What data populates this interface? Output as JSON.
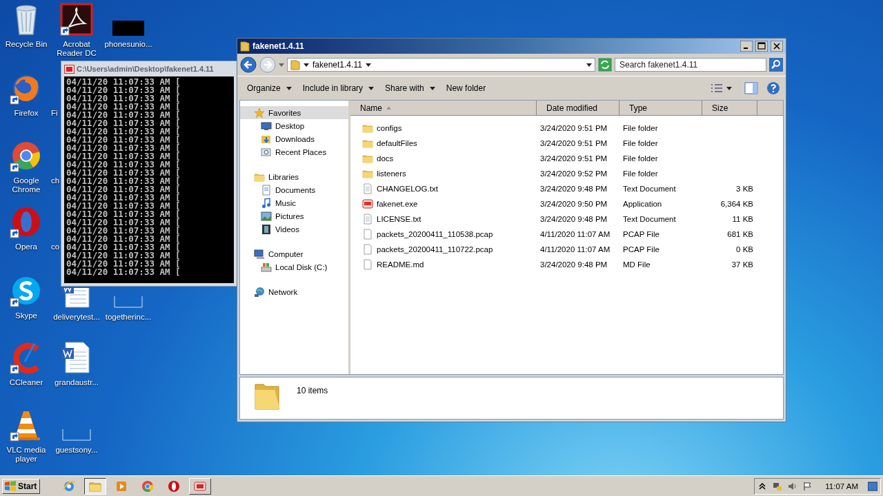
{
  "desktop_icons": [
    {
      "label": "Recycle Bin",
      "kind": "recycle-bin"
    },
    {
      "label": "Acrobat Reader DC",
      "kind": "pdf",
      "shortcut": true
    },
    {
      "label": "phonesunio...",
      "kind": "black-tile"
    },
    {
      "label": "Firefox",
      "kind": "firefox",
      "shortcut": true
    },
    {
      "label": "Fi",
      "kind": "covered"
    },
    {
      "label": "Google Chrome",
      "kind": "chrome",
      "shortcut": true
    },
    {
      "label": "ch",
      "kind": "covered"
    },
    {
      "label": "Opera",
      "kind": "opera",
      "shortcut": true
    },
    {
      "label": "co",
      "kind": "covered"
    },
    {
      "label": "Skype",
      "kind": "skype",
      "shortcut": true
    },
    {
      "label": "deliverytest...",
      "kind": "word"
    },
    {
      "label": "togetherinc...",
      "kind": "outline"
    },
    {
      "label": "CCleaner",
      "kind": "ccleaner",
      "shortcut": true
    },
    {
      "label": "grandaustr...",
      "kind": "word"
    },
    {
      "label": "VLC media player",
      "kind": "vlc",
      "shortcut": true
    },
    {
      "label": "guestsony...",
      "kind": "outline"
    }
  ],
  "console_window": {
    "title": "C:\\Users\\admin\\Desktop\\fakenet1.4.11",
    "lines": [
      "04/11/20 11:07:33 AM [",
      "04/11/20 11:07:33 AM [",
      "04/11/20 11:07:33 AM [",
      "04/11/20 11:07:33 AM [",
      "04/11/20 11:07:33 AM [",
      "04/11/20 11:07:33 AM [",
      "04/11/20 11:07:33 AM [",
      "04/11/20 11:07:33 AM [",
      "04/11/20 11:07:33 AM [",
      "04/11/20 11:07:33 AM [",
      "04/11/20 11:07:33 AM [",
      "04/11/20 11:07:33 AM [",
      "04/11/20 11:07:33 AM [",
      "04/11/20 11:07:33 AM [",
      "04/11/20 11:07:33 AM [",
      "04/11/20 11:07:33 AM [",
      "04/11/20 11:07:33 AM [",
      "04/11/20 11:07:33 AM [",
      "04/11/20 11:07:33 AM [",
      "04/11/20 11:07:33 AM [",
      "04/11/20 11:07:33 AM [",
      "04/11/20 11:07:33 AM [",
      "04/11/20 11:07:33 AM [",
      "04/11/20 11:07:33 AM ["
    ]
  },
  "explorer_window": {
    "title": "fakenet1.4.11",
    "address": "fakenet1.4.11",
    "search": {
      "placeholder": "Search fakenet1.4.11"
    },
    "toolbar": [
      {
        "label": "Organize",
        "dropdown": true
      },
      {
        "label": "Include in library",
        "dropdown": true
      },
      {
        "label": "Share with",
        "dropdown": true
      },
      {
        "label": "New folder",
        "dropdown": false
      }
    ],
    "sidebar": {
      "items": [
        {
          "label": "Favorites",
          "kind": "star",
          "selected": true,
          "children": [
            {
              "label": "Desktop",
              "kind": "desktop",
              "selected": false
            },
            {
              "label": "Downloads",
              "kind": "downloads",
              "selected": false
            },
            {
              "label": "Recent Places",
              "kind": "recent",
              "selected": false
            }
          ]
        },
        {
          "label": "Libraries",
          "kind": "libraries",
          "selected": false,
          "children": [
            {
              "label": "Documents",
              "kind": "documents",
              "selected": false
            },
            {
              "label": "Music",
              "kind": "music",
              "selected": false
            },
            {
              "label": "Pictures",
              "kind": "pictures",
              "selected": false
            },
            {
              "label": "Videos",
              "kind": "videos",
              "selected": false
            }
          ]
        },
        {
          "label": "Computer",
          "kind": "computer",
          "selected": false,
          "children": [
            {
              "label": "Local Disk (C:)",
              "kind": "disk",
              "selected": false
            }
          ]
        },
        {
          "label": "Network",
          "kind": "network",
          "selected": false
        }
      ]
    },
    "table": {
      "columns": [
        {
          "label": "Name",
          "sorted": true
        },
        {
          "label": "Date modified",
          "sorted": false
        },
        {
          "label": "Type",
          "sorted": false
        },
        {
          "label": "Size",
          "sorted": false
        }
      ],
      "rows": [
        {
          "name": "configs",
          "kind": "folder",
          "date": "3/24/2020 9:51 PM",
          "type": "File folder"
        },
        {
          "name": "defaultFiles",
          "kind": "folder",
          "date": "3/24/2020 9:51 PM",
          "type": "File folder"
        },
        {
          "name": "docs",
          "kind": "folder",
          "date": "3/24/2020 9:51 PM",
          "type": "File folder"
        },
        {
          "name": "listeners",
          "kind": "folder",
          "date": "3/24/2020 9:52 PM",
          "type": "File folder"
        },
        {
          "name": "CHANGELOG.txt",
          "kind": "text",
          "date": "3/24/2020 9:48 PM",
          "type": "Text Document",
          "size": "3 KB"
        },
        {
          "name": "fakenet.exe",
          "kind": "app",
          "date": "3/24/2020 9:50 PM",
          "type": "Application",
          "size": "6,364 KB"
        },
        {
          "name": "LICENSE.txt",
          "kind": "text",
          "date": "3/24/2020 9:48 PM",
          "type": "Text Document",
          "size": "11 KB"
        },
        {
          "name": "packets_20200411_110538.pcap",
          "kind": "file",
          "date": "4/11/2020 11:07 AM",
          "type": "PCAP File",
          "size": "681 KB"
        },
        {
          "name": "packets_20200411_110722.pcap",
          "kind": "file",
          "date": "4/11/2020 11:07 AM",
          "type": "PCAP File",
          "size": "0 KB"
        },
        {
          "name": "README.md",
          "kind": "file",
          "date": "3/24/2020 9:48 PM",
          "type": "MD File",
          "size": "37 KB"
        }
      ]
    },
    "details_pane": {
      "summary": "10 items"
    }
  },
  "taskbar": {
    "start": "Start",
    "items": [
      {
        "kind": "ie",
        "selected": false
      },
      {
        "kind": "explorer",
        "selected": true
      },
      {
        "kind": "media",
        "selected": false
      },
      {
        "kind": "chrome",
        "selected": false
      },
      {
        "kind": "opera",
        "selected": false
      },
      {
        "kind": "app",
        "selected": false,
        "button": true
      }
    ],
    "clock": "11:07 AM"
  }
}
